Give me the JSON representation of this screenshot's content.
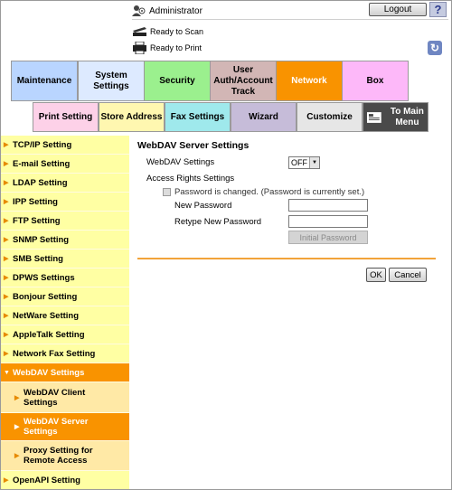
{
  "header": {
    "user_label": "Administrator",
    "logout_label": "Logout",
    "help_label": "?",
    "status": [
      {
        "icon": "scanner-icon",
        "text": "Ready to Scan"
      },
      {
        "icon": "printer-icon",
        "text": "Ready to Print"
      }
    ]
  },
  "tabs": {
    "main": [
      {
        "label": "Maintenance",
        "color": "#b9d5ff"
      },
      {
        "label": "System Settings",
        "color": "#ddeaff"
      },
      {
        "label": "Security",
        "color": "#9bf08e"
      },
      {
        "label": "User Auth/Account Track",
        "color": "#d2b6b5"
      },
      {
        "label": "Network",
        "color": "#f99300",
        "selected": true
      },
      {
        "label": "Box",
        "color": "#fdb8f9"
      }
    ],
    "sub": [
      {
        "label": "Print Setting",
        "color": "#fdd1e8"
      },
      {
        "label": "Store Address",
        "color": "#fff7b0"
      },
      {
        "label": "Fax Settings",
        "color": "#9fe9ec"
      },
      {
        "label": "Wizard",
        "color": "#c6bcd9"
      },
      {
        "label": "Customize",
        "color": "#e6e6e6"
      },
      {
        "label": "To Main Menu",
        "color": "#4a4a4a"
      }
    ]
  },
  "sidebar": {
    "items": [
      {
        "label": "TCP/IP Setting"
      },
      {
        "label": "E-mail Setting"
      },
      {
        "label": "LDAP Setting"
      },
      {
        "label": "IPP Setting"
      },
      {
        "label": "FTP Setting"
      },
      {
        "label": "SNMP Setting"
      },
      {
        "label": "SMB Setting"
      },
      {
        "label": "DPWS Settings"
      },
      {
        "label": "Bonjour Setting"
      },
      {
        "label": "NetWare Setting"
      },
      {
        "label": "AppleTalk Setting"
      },
      {
        "label": "Network Fax Setting"
      },
      {
        "label": "WebDAV Settings",
        "selected": true,
        "expanded": true
      },
      {
        "label": "WebDAV Client Settings",
        "child": true
      },
      {
        "label": "WebDAV Server Settings",
        "child": true,
        "selected": true
      },
      {
        "label": "Proxy Setting for Remote Access",
        "child": true
      },
      {
        "label": "OpenAPI Setting"
      }
    ]
  },
  "main": {
    "title": "WebDAV Server Settings",
    "webdav_settings_label": "WebDAV Settings",
    "webdav_settings_value": "OFF",
    "access_rights_label": "Access Rights Settings",
    "password_changed_label": "Password is changed.  (Password is currently set.)",
    "new_password_label": "New Password",
    "new_password_value": "",
    "retype_password_label": "Retype New Password",
    "retype_password_value": "",
    "initial_password_label": "Initial Password",
    "ok_label": "OK",
    "cancel_label": "Cancel"
  },
  "colors": {
    "accent": "#f99300",
    "sidebar_bg": "#ffffa3",
    "sidebar_child_bg": "#ffe9a6"
  }
}
